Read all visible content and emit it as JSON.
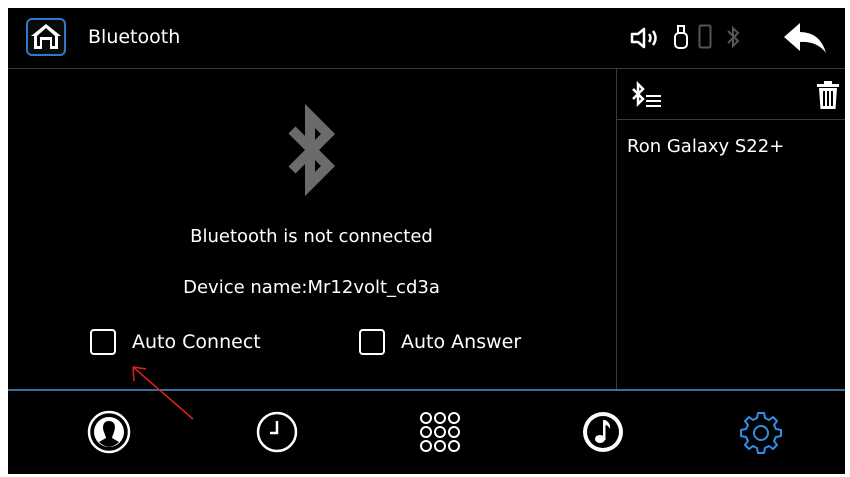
{
  "header": {
    "title": "Bluetooth",
    "icons": [
      "home-icon",
      "volume-icon",
      "usb-icon",
      "phone-icon",
      "bluetooth-status-icon",
      "back-arrow-icon"
    ]
  },
  "main": {
    "status_text": "Bluetooth is not connected",
    "device_name": "Device name:Mr12volt_cd3a",
    "options": [
      {
        "label": "Auto Connect",
        "checked": false
      },
      {
        "label": "Auto Answer",
        "checked": false
      }
    ]
  },
  "devices": {
    "items": [
      "Ron Galaxy S22+"
    ],
    "icons": [
      "bluetooth-list-icon",
      "trash-icon"
    ]
  },
  "bottom_nav": {
    "items": [
      "contacts-icon",
      "recent-calls-icon",
      "dialpad-icon",
      "music-icon",
      "settings-icon"
    ],
    "active": "settings-icon"
  },
  "colors": {
    "background": "#000000",
    "accent": "#2f78d0",
    "settings_active": "#2f8ee8",
    "divider": "#3c6e98"
  }
}
